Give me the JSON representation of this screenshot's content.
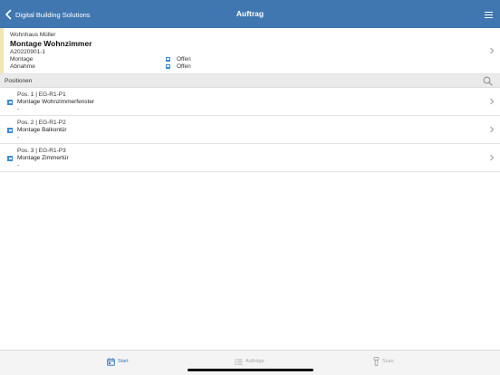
{
  "navbar": {
    "back_label": "Digital Building Solutions",
    "title": "Auftrag",
    "background_color": "#4077b0",
    "menu_icon": "hamburger-menu-icon"
  },
  "order": {
    "subtitle": "Wohnhaus Müller",
    "title": "Montage Wohnzimmer",
    "number": "A20220901-1",
    "accent_color": "#f2e6b3",
    "statuses": [
      {
        "label": "Montage",
        "value": "Offen"
      },
      {
        "label": "Abnahme",
        "value": "Offen"
      }
    ]
  },
  "positions": {
    "header": "Positionen",
    "status_color": "#3d8ad6",
    "items": [
      {
        "code": "Pos. 1 | EG-R1-P1",
        "name": "Montage Wohnzimmerfenster",
        "extra": "-"
      },
      {
        "code": "Pos. 2 | EG-R1-P2",
        "name": "Montage Balkontür",
        "extra": "-"
      },
      {
        "code": "Pos. 3 | EG-R1-P3",
        "name": "Montage Zimmertür",
        "extra": "-"
      }
    ]
  },
  "tabbar": {
    "active_color": "#3a78c2",
    "inactive_color": "#a8a8a8",
    "tabs": [
      {
        "label": "Start",
        "icon": "calendar-icon",
        "active": true
      },
      {
        "label": "Aufträge",
        "icon": "list-icon",
        "active": false
      },
      {
        "label": "Scan",
        "icon": "scanner-icon",
        "active": false
      }
    ]
  }
}
